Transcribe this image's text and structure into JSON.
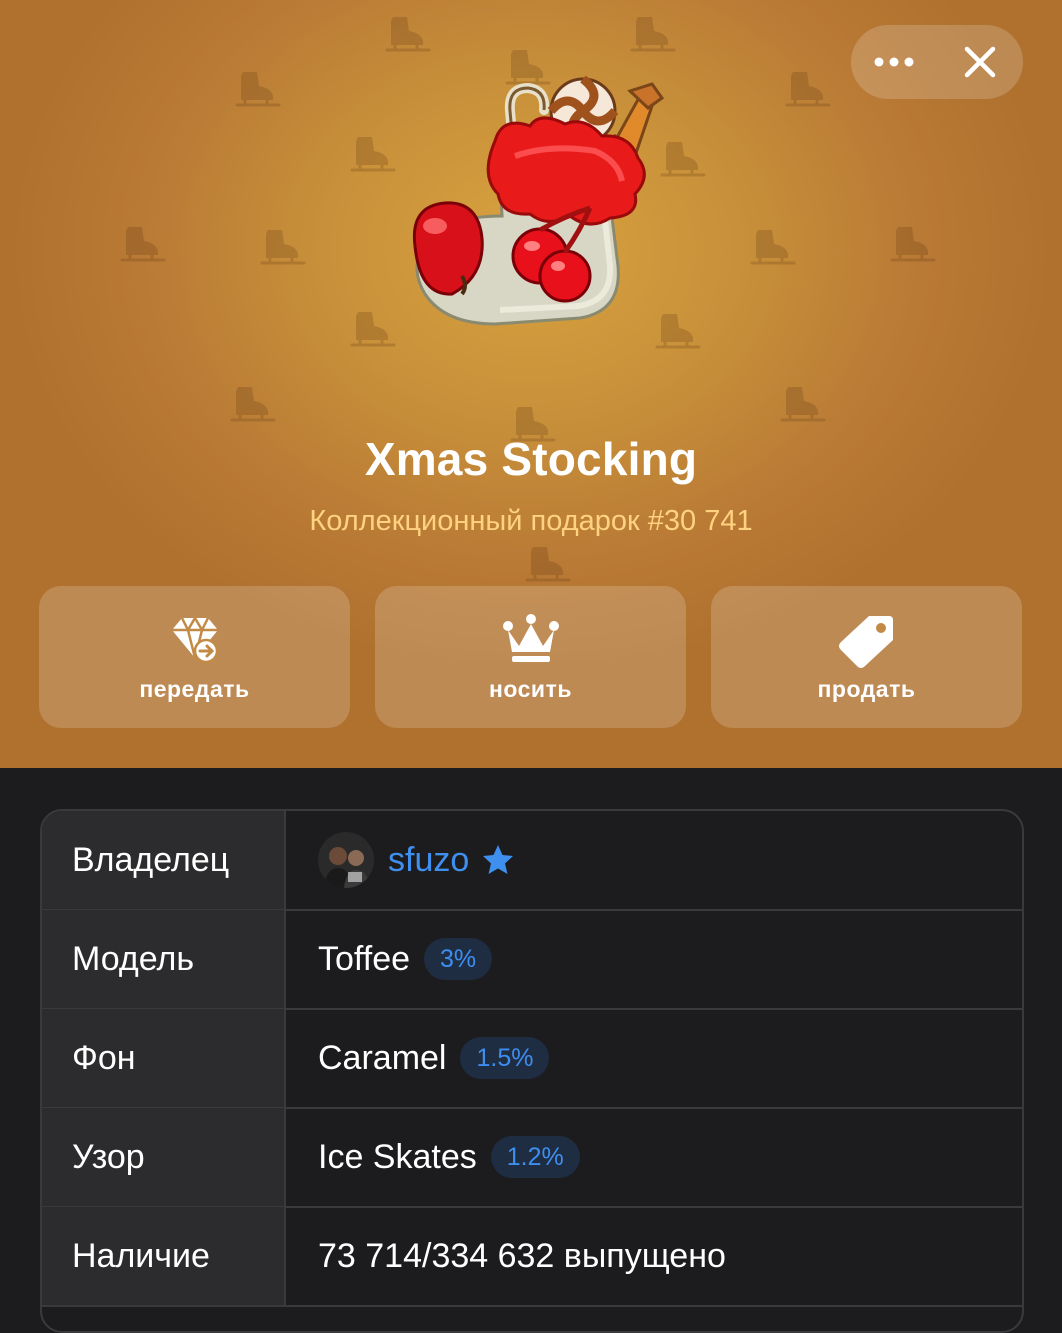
{
  "header": {
    "title": "Xmas Stocking",
    "subtitle": "Коллекционный подарок #30 741",
    "more_icon": "more-horizontal-icon",
    "close_icon": "close-icon",
    "background_color": "#c8903a",
    "pattern_icon": "ice-skate-icon"
  },
  "actions": [
    {
      "label": "передать",
      "icon": "diamond-transfer-icon"
    },
    {
      "label": "носить",
      "icon": "crown-icon"
    },
    {
      "label": "продать",
      "icon": "price-tag-icon"
    }
  ],
  "details": {
    "owner": {
      "label": "Владелец",
      "name": "sfuzo",
      "badge_icon": "premium-star-icon"
    },
    "model": {
      "label": "Модель",
      "value": "Toffee",
      "percent": "3%"
    },
    "backdrop": {
      "label": "Фон",
      "value": "Caramel",
      "percent": "1.5%"
    },
    "symbol": {
      "label": "Узор",
      "value": "Ice Skates",
      "percent": "1.2%"
    },
    "availability": {
      "label": "Наличие",
      "value": "73 714/334 632 выпущено"
    }
  },
  "colors": {
    "accent": "#3f8fef",
    "subtitle": "#ffd27f"
  }
}
